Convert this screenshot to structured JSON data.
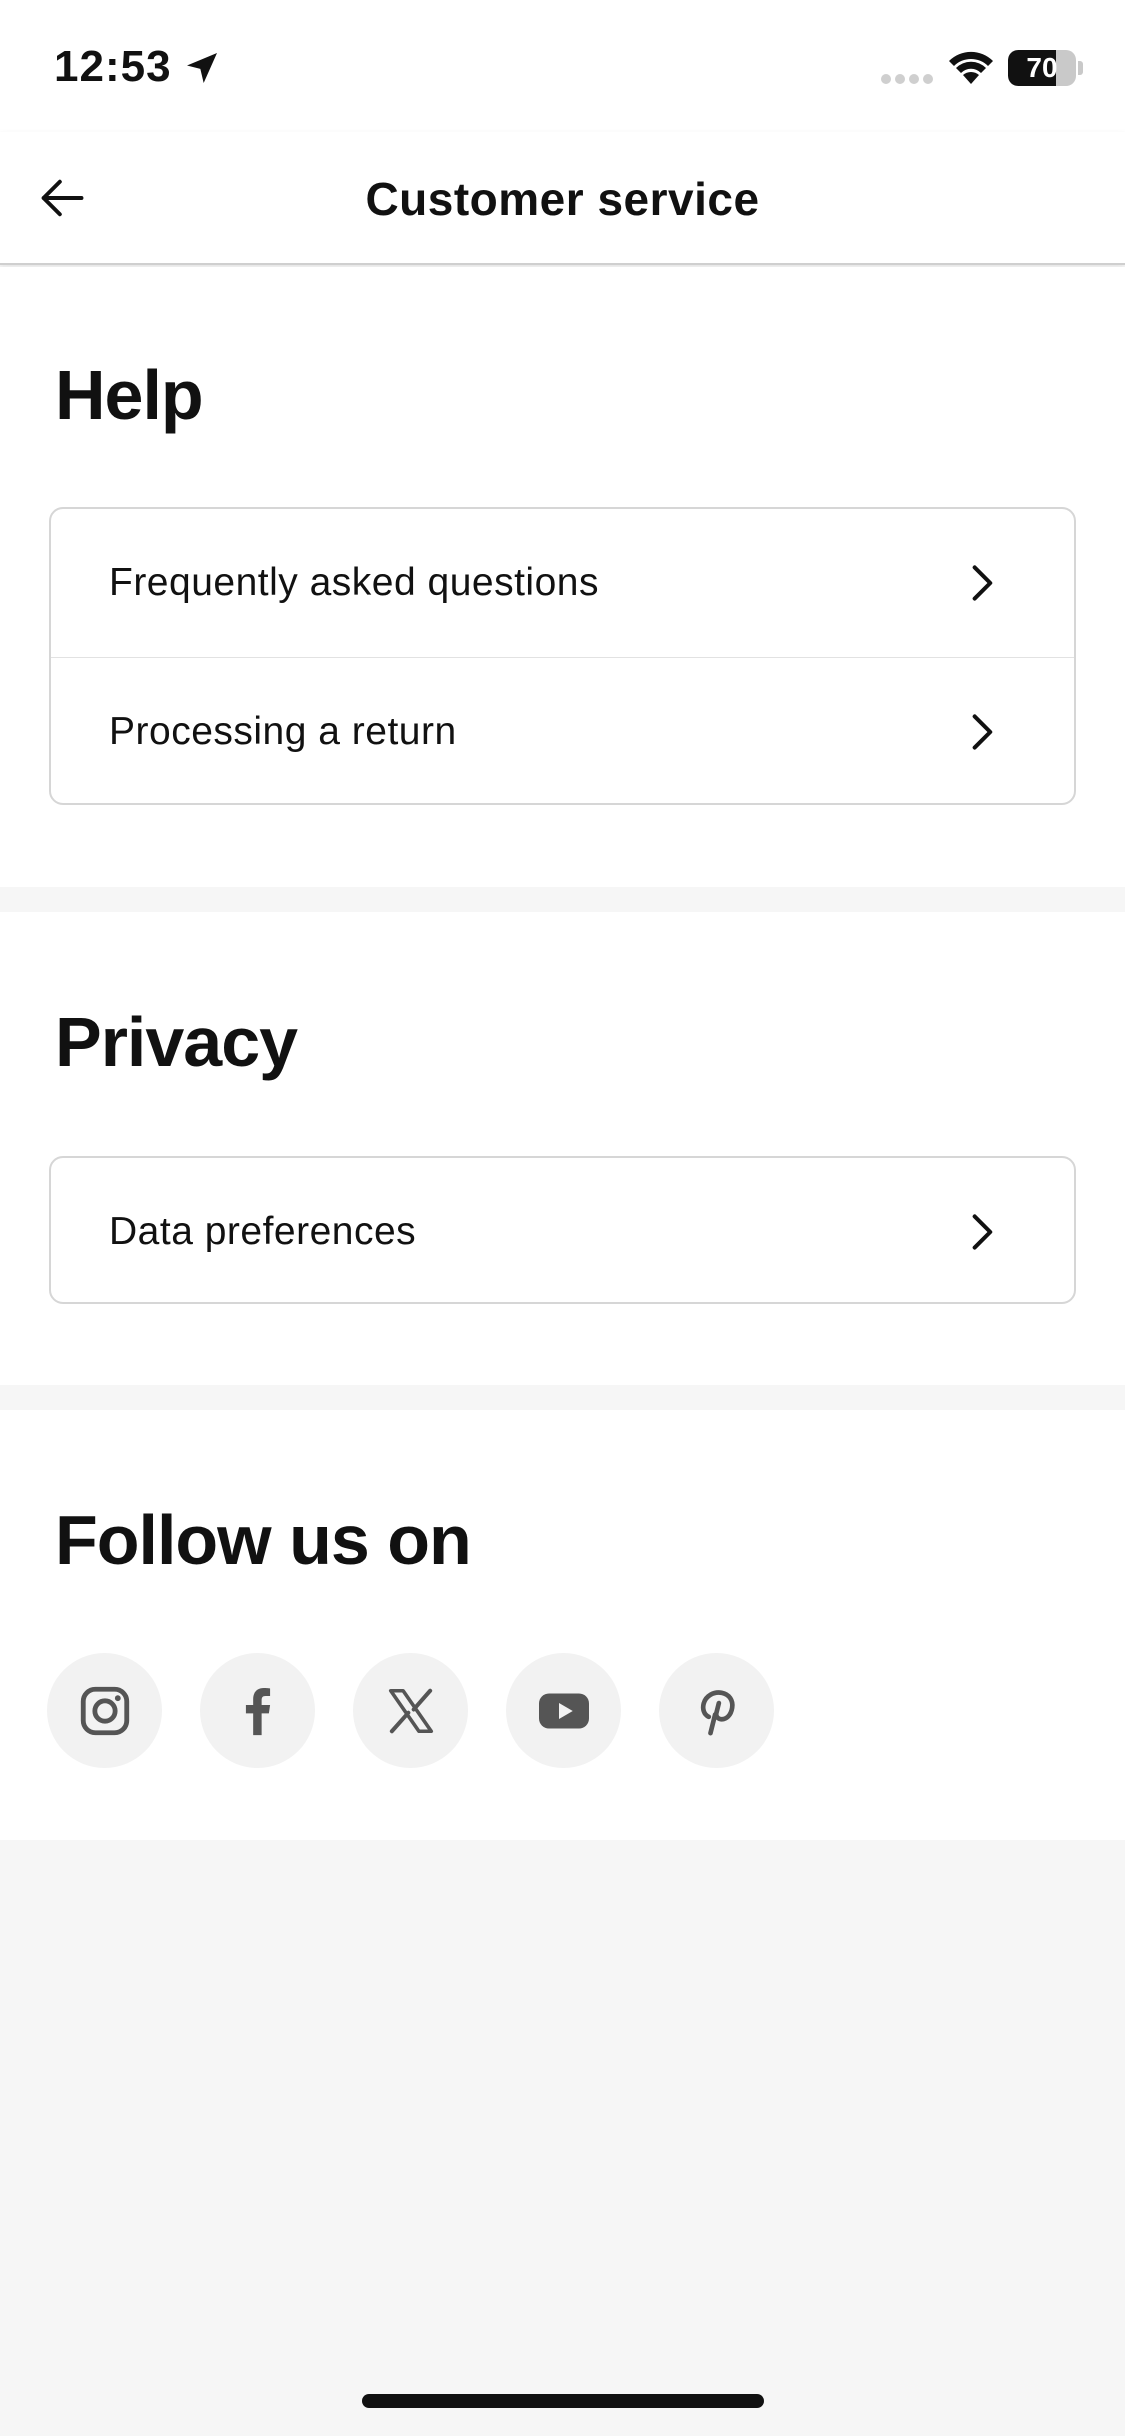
{
  "status_bar": {
    "time": "12:53",
    "battery_level": "70",
    "battery_fraction": 0.7
  },
  "nav": {
    "title": "Customer service"
  },
  "sections": {
    "help": {
      "title": "Help",
      "items": [
        {
          "label": "Frequently asked questions"
        },
        {
          "label": "Processing a return"
        }
      ]
    },
    "privacy": {
      "title": "Privacy",
      "items": [
        {
          "label": "Data preferences"
        }
      ]
    },
    "follow": {
      "title": "Follow us on",
      "social": [
        {
          "icon": "instagram-icon"
        },
        {
          "icon": "facebook-icon"
        },
        {
          "icon": "x-twitter-icon"
        },
        {
          "icon": "youtube-icon"
        },
        {
          "icon": "pinterest-icon"
        }
      ]
    }
  },
  "colors": {
    "text": "#111111",
    "icon_gray": "#555555",
    "icon_bg": "#f2f2f2",
    "background": "#f6f6f6",
    "card_border": "#d6d6d6"
  }
}
